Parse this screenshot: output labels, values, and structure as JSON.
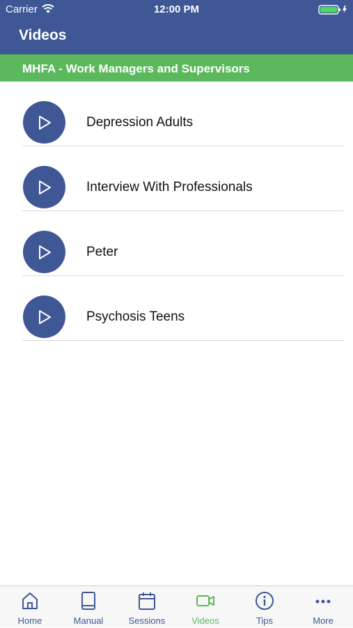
{
  "status_bar": {
    "carrier": "Carrier",
    "time": "12:00 PM"
  },
  "header": {
    "title": "Videos"
  },
  "section": {
    "title": "MHFA - Work Managers and Supervisors"
  },
  "videos": [
    {
      "title": "Depression Adults",
      "icon": "play-icon"
    },
    {
      "title": "Interview With Professionals",
      "icon": "play-icon"
    },
    {
      "title": "Peter",
      "icon": "play-icon"
    },
    {
      "title": "Psychosis Teens",
      "icon": "play-icon"
    }
  ],
  "tabbar": {
    "items": [
      {
        "label": "Home",
        "icon": "home-icon",
        "active": false
      },
      {
        "label": "Manual",
        "icon": "book-icon",
        "active": false
      },
      {
        "label": "Sessions",
        "icon": "calendar-icon",
        "active": false
      },
      {
        "label": "Videos",
        "icon": "video-camera-icon",
        "active": true
      },
      {
        "label": "Tips",
        "icon": "info-icon",
        "active": false
      },
      {
        "label": "More",
        "icon": "more-icon",
        "active": false
      }
    ]
  },
  "colors": {
    "primary": "#3f5795",
    "accent": "#5cb85c",
    "text": "#111111",
    "divider": "#dcdcdc"
  }
}
